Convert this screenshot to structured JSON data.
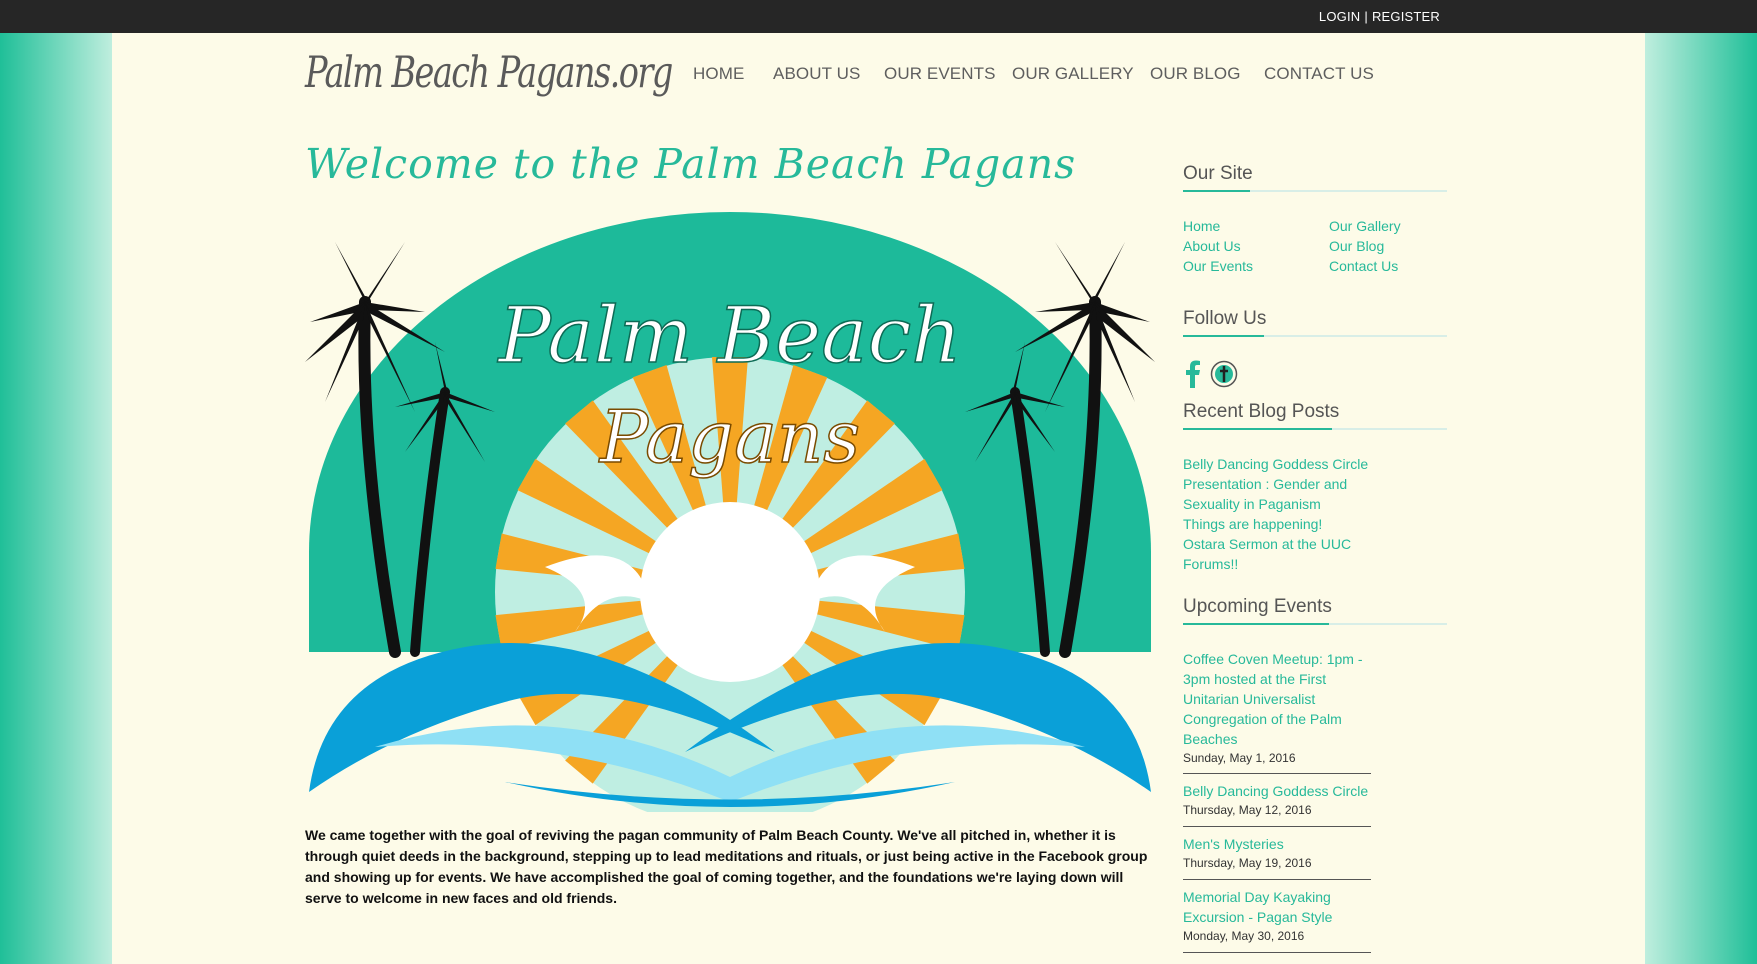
{
  "auth": {
    "login": "LOGIN",
    "separator": "|",
    "register": "REGISTER"
  },
  "logo": {
    "text": "Palm Beach Pagans.org"
  },
  "nav": [
    "HOME",
    "ABOUT US",
    "OUR EVENTS",
    "OUR GALLERY",
    "OUR BLOG",
    "CONTACT US"
  ],
  "welcome": "Welcome to the Palm Beach Pagans",
  "hero": {
    "line1": "Palm Beach",
    "line2": "Pagans"
  },
  "intro": "We came together with the goal of reviving the pagan community of Palm Beach County. We've all pitched in, whether it is through quiet deeds in the background, stepping up to lead meditations and rituals, or just being active in the Facebook group and showing up for events. We have accomplished the goal of coming together, and the foundations we're laying down will serve to welcome in new faces and old friends.",
  "sidebar": {
    "our_site": {
      "title": "Our Site",
      "links": [
        "Home",
        "About Us",
        "Our Events",
        "Our Gallery",
        "Our Blog",
        "Contact Us"
      ]
    },
    "follow": {
      "title": "Follow Us",
      "icons": [
        "facebook-icon",
        "meetup-icon"
      ]
    },
    "recent": {
      "title": "Recent Blog Posts",
      "posts": [
        "Belly Dancing Goddess Circle",
        "Presentation : Gender and",
        "Sexuality in Paganism",
        "Things are happening!",
        "Ostara Sermon at the UUC",
        "Forums!!"
      ]
    },
    "events": {
      "title": "Upcoming Events",
      "items": [
        {
          "lines": [
            "Coffee Coven Meetup: 1pm -",
            "3pm hosted at the First",
            "Unitarian Universalist",
            "Congregation of the Palm",
            "Beaches"
          ],
          "date": "Sunday, May 1, 2016"
        },
        {
          "lines": [
            "Belly Dancing Goddess Circle"
          ],
          "date": "Thursday, May 12, 2016"
        },
        {
          "lines": [
            "Men's Mysteries"
          ],
          "date": "Thursday, May 19, 2016"
        },
        {
          "lines": [
            "Memorial Day Kayaking",
            "Excursion - Pagan Style"
          ],
          "date": "Monday, May 30, 2016"
        }
      ]
    }
  },
  "colors": {
    "accent": "#27b99a",
    "topbar": "#262626",
    "background": "#fdfbe8",
    "sun": "#f5a623",
    "wave": "#0aa0d8"
  }
}
